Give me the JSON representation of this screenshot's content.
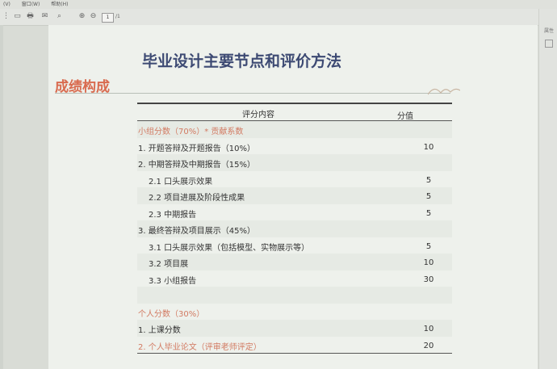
{
  "menu": [
    "(V)",
    "窗口(W)",
    "帮助(H)"
  ],
  "toolbar": {
    "page_value": "1",
    "page_total": "/1"
  },
  "right_panel": {
    "label": "属性"
  },
  "slide": {
    "title": "毕业设计主要节点和评价方法",
    "section": "成绩构成"
  },
  "table": {
    "header_content": "评分内容",
    "header_value": "分值",
    "rows": [
      {
        "text": "小组分数（70%）* 贡献系数",
        "value": "",
        "indent": 0,
        "red": true
      },
      {
        "text": "1. 开题答辩及开题报告（10%）",
        "value": "10",
        "indent": 0,
        "red": false
      },
      {
        "text": "2. 中期答辩及中期报告（15%）",
        "value": "",
        "indent": 0,
        "red": false
      },
      {
        "text": "2.1 口头展示效果",
        "value": "5",
        "indent": 1,
        "red": false
      },
      {
        "text": "2.2 项目进展及阶段性成果",
        "value": "5",
        "indent": 1,
        "red": false
      },
      {
        "text": "2.3 中期报告",
        "value": "5",
        "indent": 1,
        "red": false
      },
      {
        "text": "3. 最终答辩及项目展示（45%）",
        "value": "",
        "indent": 0,
        "red": false
      },
      {
        "text": "3.1 口头展示效果（包括模型、实物展示等）",
        "value": "5",
        "indent": 1,
        "red": false
      },
      {
        "text": "3.2 项目展",
        "value": "10",
        "indent": 1,
        "red": false
      },
      {
        "text": "3.3 小组报告",
        "value": "30",
        "indent": 1,
        "red": false
      },
      {
        "text": "",
        "value": "",
        "indent": 0,
        "red": false
      },
      {
        "text": "个人分数（30%）",
        "value": "",
        "indent": 0,
        "red": true
      },
      {
        "text": "1. 上课分数",
        "value": "10",
        "indent": 0,
        "red": false
      },
      {
        "text": "2. 个人毕业论文（评审老师评定）",
        "value": "20",
        "indent": 0,
        "red": true
      }
    ]
  }
}
